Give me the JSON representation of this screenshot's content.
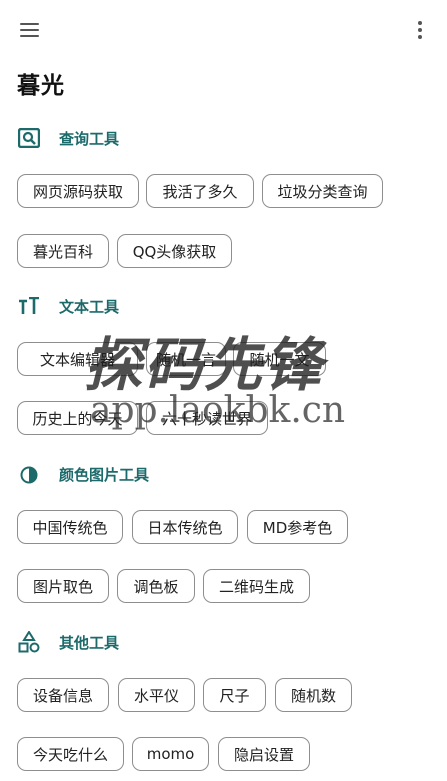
{
  "app": {
    "title": "暮光"
  },
  "sections": [
    {
      "title": "查询工具",
      "icon": "search-box-icon",
      "items": [
        "网页源码获取",
        "我活了多久",
        "垃圾分类查询",
        "暮光百科",
        "QQ头像获取"
      ]
    },
    {
      "title": "文本工具",
      "icon": "text-size-icon",
      "items": [
        "文本编辑器",
        "随机一言",
        "随机一文",
        "历史上的今天",
        "六十秒读世界"
      ]
    },
    {
      "title": "颜色图片工具",
      "icon": "color-drop-icon",
      "items": [
        "中国传统色",
        "日本传统色",
        "MD参考色",
        "图片取色",
        "调色板",
        "二维码生成"
      ]
    },
    {
      "title": "其他工具",
      "icon": "shapes-icon",
      "items": [
        "设备信息",
        "水平仪",
        "尺子",
        "随机数",
        "今天吃什么",
        "momo",
        "隐启设置"
      ]
    }
  ],
  "watermark": {
    "brand": "探码先锋",
    "url": "app.laokbk.cn"
  },
  "colors": {
    "accent": "#1d6a6b",
    "chip_border": "#8e8e8e",
    "icon": "#1d6a6b"
  }
}
